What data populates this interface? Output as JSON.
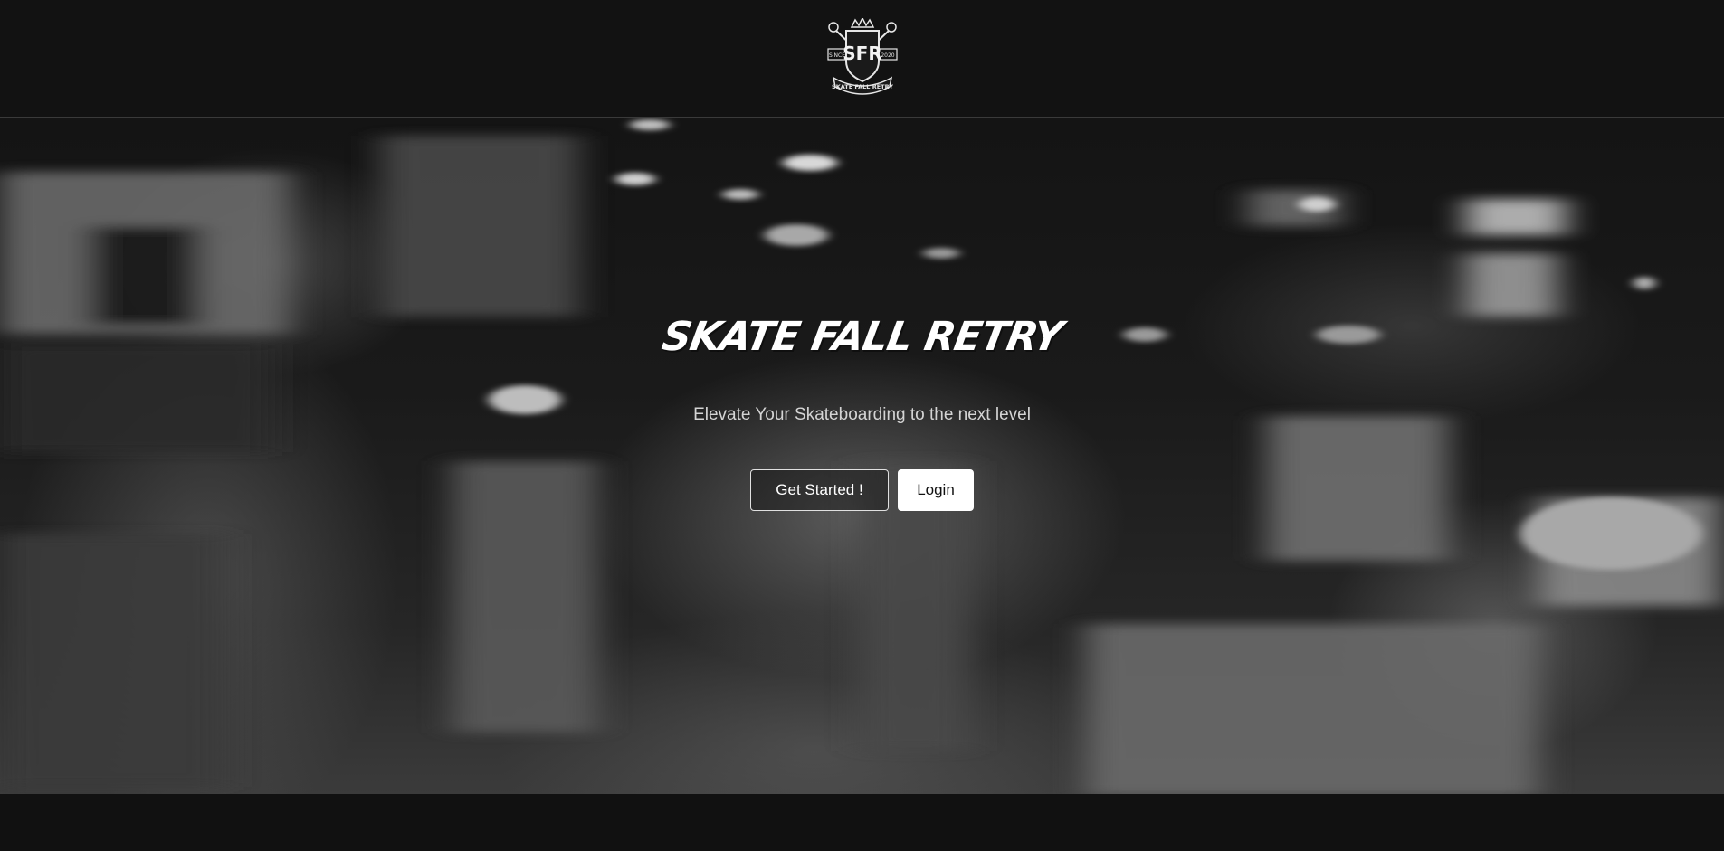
{
  "header": {
    "logo": {
      "initials": "SFR",
      "left_tag": "SINCE",
      "right_tag": "2020",
      "ribbon": "SKATE FALL RETRY",
      "icon": "crown-crest-icon"
    }
  },
  "hero": {
    "brand": "SKATE FALL RETRY",
    "tagline": "Elevate Your Skateboarding to the next level",
    "buttons": {
      "get_started": "Get Started !",
      "login": "Login"
    }
  },
  "colors": {
    "background": "#111111",
    "header_border": "#3a3a3a",
    "text": "#ffffff",
    "tagline": "#d4d4d4"
  }
}
